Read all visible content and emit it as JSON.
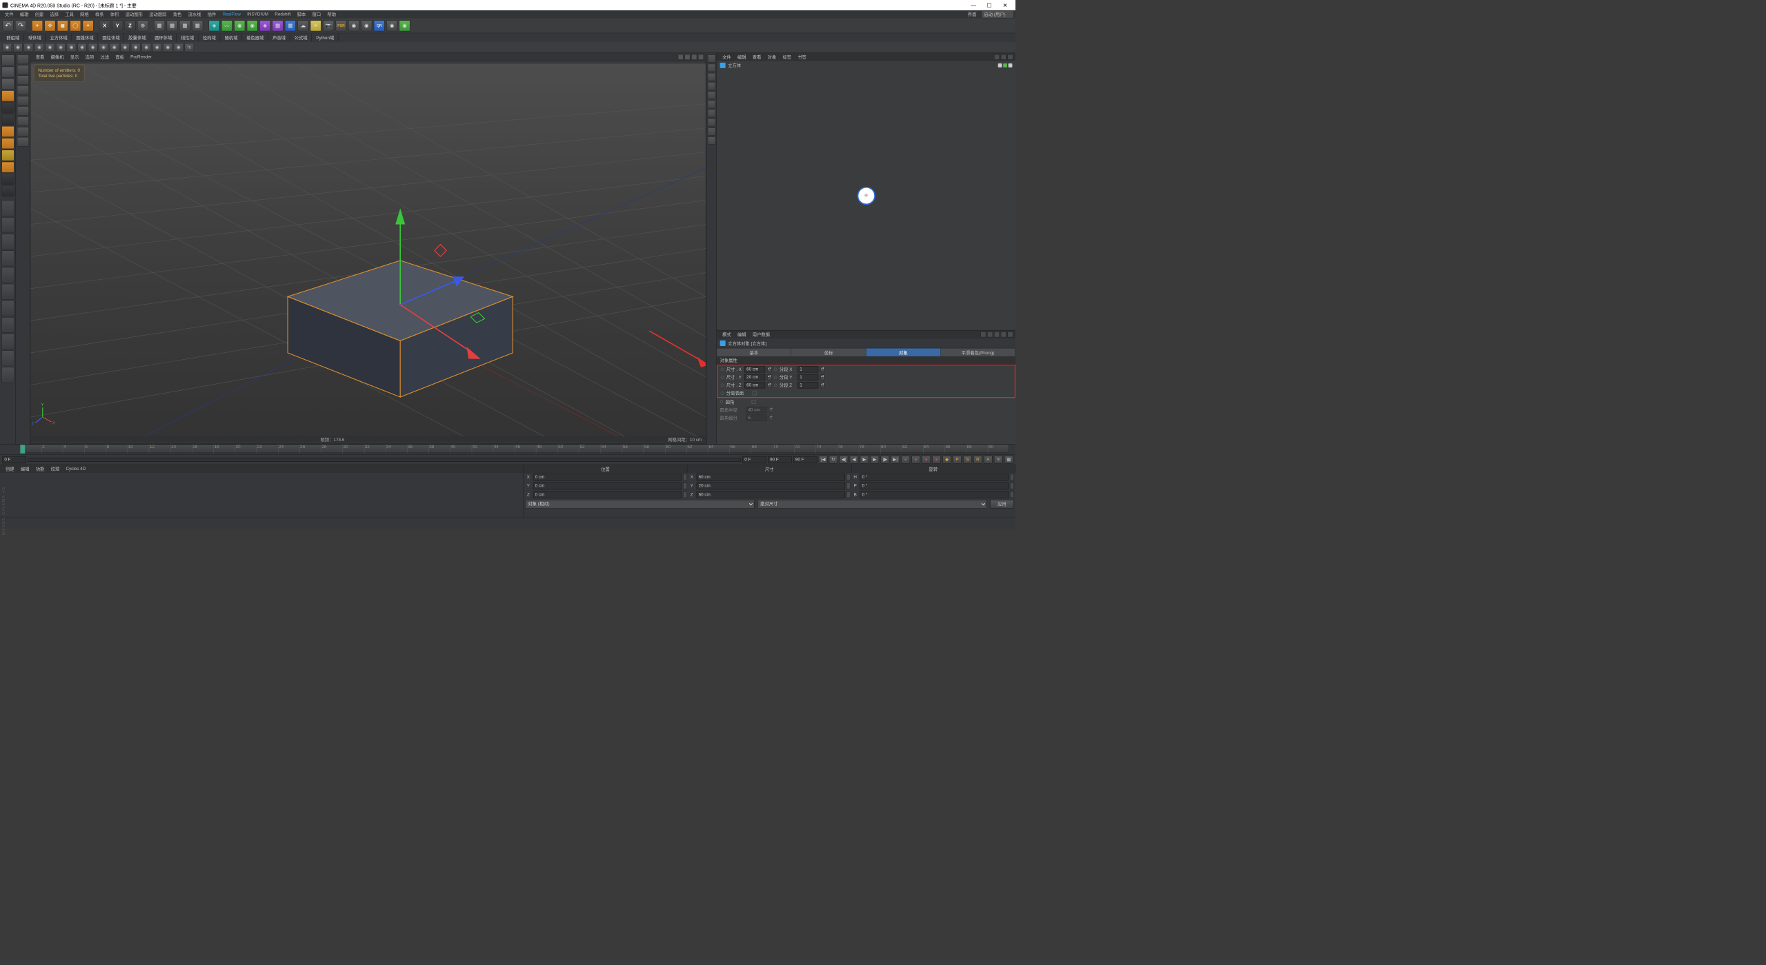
{
  "window": {
    "title": "CINEMA 4D R20.059 Studio (RC - R20) - [未标题 1 *] - 主要",
    "layout_label": "界面",
    "layout_value": "启动 (用户)"
  },
  "menubar": [
    "文件",
    "编辑",
    "创建",
    "选择",
    "工具",
    "网格",
    "样条",
    "体积",
    "运动图形",
    "运动跟踪",
    "角色",
    "流水线",
    "插件",
    "RealFlow",
    "INSYDIUM",
    "Redshift",
    "脚本",
    "窗口",
    "帮助"
  ],
  "fieldsbar": [
    "群组域",
    "球体域",
    "立方体域",
    "圆锥体域",
    "圆柱体域",
    "胶囊体域",
    "圆环体域",
    "线性域",
    "径向域",
    "随机域",
    "着色器域",
    "声音域",
    "公式域",
    "Python域"
  ],
  "viewport_menu": [
    "查看",
    "摄像机",
    "显示",
    "选项",
    "过滤",
    "面板",
    "ProRender"
  ],
  "vp_overlay": {
    "line1": "Number of emitters: 0",
    "line2": "Total live particles: 0"
  },
  "vp_status": {
    "fps": "帧频：178.6",
    "grid": "网格间距：10 cm"
  },
  "timeline": {
    "ticks": [
      "0",
      "2",
      "4",
      "6",
      "8",
      "10",
      "12",
      "14",
      "16",
      "18",
      "20",
      "22",
      "24",
      "26",
      "28",
      "30",
      "32",
      "34",
      "36",
      "38",
      "40",
      "42",
      "44",
      "46",
      "48",
      "50",
      "52",
      "54",
      "56",
      "58",
      "60",
      "62",
      "64",
      "66",
      "68",
      "70",
      "72",
      "74",
      "76",
      "78",
      "80",
      "82",
      "84",
      "86",
      "88",
      "90"
    ],
    "start": "0 F",
    "current": "0 F",
    "end1": "90 F",
    "end2": "90 F"
  },
  "objmgr": {
    "menus": [
      "文件",
      "编辑",
      "查看",
      "对象",
      "标签",
      "书签"
    ],
    "item": "立方体"
  },
  "attrmgr": {
    "menus": [
      "模式",
      "编辑",
      "用户数据"
    ],
    "title": "立方体对象 [立方体]",
    "tabs": [
      "基本",
      "坐标",
      "对象",
      "平滑着色(Phong)"
    ],
    "section": "对象属性",
    "size_x_label": "尺寸 . X",
    "size_x": "60 cm",
    "seg_x_label": "分段 X",
    "seg_x": "1",
    "size_y_label": "尺寸 . Y",
    "size_y": "20 cm",
    "seg_y_label": "分段 Y",
    "seg_y": "1",
    "size_z_label": "尺寸 . Z",
    "size_z": "60 cm",
    "seg_z_label": "分段 Z",
    "seg_z": "1",
    "sep_surf": "分离表面",
    "fillet": "圆角",
    "fillet_r_label": "圆角半径",
    "fillet_r": "40 cm",
    "fillet_s_label": "圆角细分",
    "fillet_s": "5"
  },
  "material_menus": [
    "创建",
    "编辑",
    "功能",
    "纹理",
    "Cycles 4D"
  ],
  "coord": {
    "headers": [
      "位置",
      "尺寸",
      "旋转"
    ],
    "px": "0 cm",
    "sx": "60 cm",
    "rh": "0 °",
    "py": "0 cm",
    "sy": "20 cm",
    "rp": "0 °",
    "pz": "0 cm",
    "sz": "60 cm",
    "rb": "0 °",
    "mode1": "对象 (相对)",
    "mode2": "绝对尺寸",
    "apply": "应用"
  },
  "brand": "MAXON CINEMA 4D"
}
